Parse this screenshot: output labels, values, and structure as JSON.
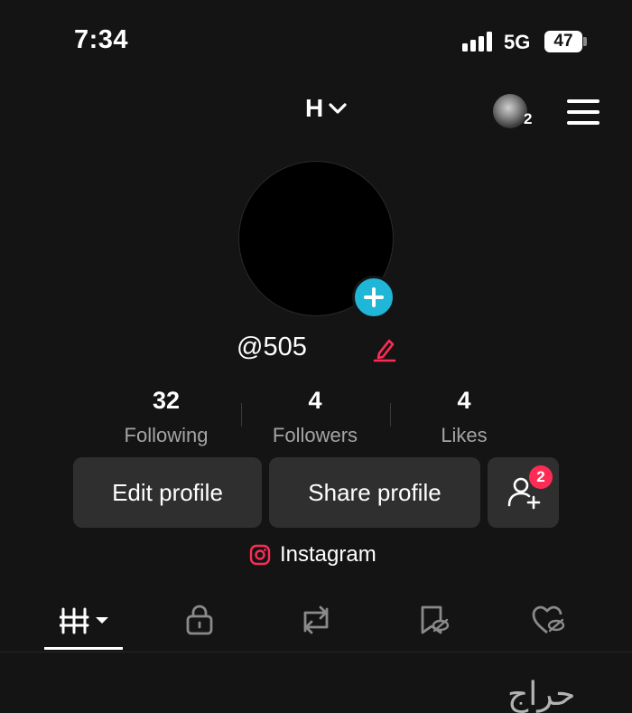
{
  "status_bar": {
    "time": "7:34",
    "network": "5G",
    "battery": "47"
  },
  "header": {
    "account_name": "H",
    "friends_count": "2"
  },
  "profile": {
    "handle": "@505"
  },
  "stats": [
    {
      "value": "32",
      "label": "Following"
    },
    {
      "value": "4",
      "label": "Followers"
    },
    {
      "value": "4",
      "label": "Likes"
    }
  ],
  "actions": {
    "edit_profile": "Edit profile",
    "share_profile": "Share profile",
    "find_friends_badge": "2"
  },
  "links": {
    "instagram": "Instagram"
  },
  "tabs": [
    "videos",
    "private",
    "reposts",
    "favorites",
    "liked"
  ],
  "colors": {
    "accent_cyan": "#1fb6d8",
    "accent_red": "#fe2c55",
    "background": "#141414",
    "button": "#2f2f2f"
  },
  "watermark": "حراج"
}
